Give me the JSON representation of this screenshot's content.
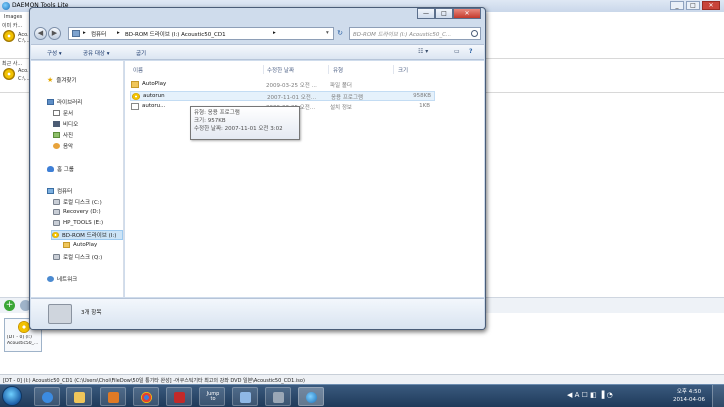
{
  "daemon": {
    "title": "DAEMON Tools Lite",
    "images_section": "Images",
    "image_catalog_label": "이미 카...",
    "recent_label": "최근 사...",
    "catalog_items": [
      {
        "name": "Aco...",
        "sub": "C:\\..."
      },
      {
        "name": "Aco...",
        "sub": "C:\\..."
      }
    ],
    "vdrive_label_1": "[DT - 0] (I:)",
    "vdrive_label_2": "Acoustic50_...",
    "status_text": "[DT - 0] (I:) Acoustic50_CD1 (C:\\Users\\Choi\\FileDow\\50일 통기타 완성] -어쿠스틱기타 최고의 강좌 DVD 일본\\Acoustic50_CD1.iso)"
  },
  "explorer": {
    "controls": {
      "min": "—",
      "max": "□",
      "close": "✕"
    },
    "address": {
      "crumbs": [
        "컴퓨터",
        "BD-ROM 드라이브 (I:) Acoustic50_CD1"
      ],
      "separator": "▸"
    },
    "search_placeholder": "BD-ROM 드라이브 (I:) Acoustic50_C...",
    "commands": {
      "organize": "구성 ▾",
      "share": "공유 대상 ▾",
      "burn": "굽기",
      "view": "☷ ▾",
      "help": "?"
    },
    "nav": [
      {
        "label": "즐겨찾기",
        "icon": "star-icon",
        "indent": 0
      },
      {
        "label": "라이브러리",
        "icon": "library-icon",
        "indent": 0
      },
      {
        "label": "문서",
        "icon": "documents-icon",
        "indent": 1
      },
      {
        "label": "비디오",
        "icon": "video-icon",
        "indent": 1
      },
      {
        "label": "사진",
        "icon": "pictures-icon",
        "indent": 1
      },
      {
        "label": "음악",
        "icon": "music-icon",
        "indent": 1
      },
      {
        "label": "홈 그룹",
        "icon": "homegroup-icon",
        "indent": 0
      },
      {
        "label": "컴퓨터",
        "icon": "computer-icon",
        "indent": 0
      },
      {
        "label": "로컬 디스크 (C:)",
        "icon": "hard-disk-icon",
        "indent": 1
      },
      {
        "label": "Recovery (D:)",
        "icon": "hard-disk-icon",
        "indent": 1
      },
      {
        "label": "HP_TOOLS (E:)",
        "icon": "hard-disk-icon",
        "indent": 1
      },
      {
        "label": "BD-ROM 드라이브 (I:)",
        "icon": "cd-drive-icon",
        "indent": 1,
        "selected": true
      },
      {
        "label": "AutoPlay",
        "icon": "folder-icon",
        "indent": 2
      },
      {
        "label": "로컬 디스크 (Q:)",
        "icon": "hard-disk-icon",
        "indent": 1
      },
      {
        "label": "네트워크",
        "icon": "network-icon",
        "indent": 0
      }
    ],
    "columns": {
      "name": "이름",
      "date": "수정한 날짜",
      "type": "유형",
      "size": "크기"
    },
    "files": [
      {
        "name": "AutoPlay",
        "date": "2009-03-25 오전 ...",
        "type": "파일 폴더",
        "size": "",
        "icon": "folder-icon"
      },
      {
        "name": "autorun",
        "date": "2007-11-01 오전...",
        "type": "응용 프로그램",
        "size": "958KB",
        "icon": "app-icon"
      },
      {
        "name": "autoru...",
        "date": "2009-03-25 오전...",
        "type": "설치 정보",
        "size": "1KB",
        "icon": "setup-info-icon"
      }
    ],
    "tooltip": {
      "line1": "유형: 응용 프로그램",
      "line2": "크기: 957KB",
      "line3": "수정한 날짜: 2007-11-01 오전 3:02"
    },
    "details": {
      "count": "3개 항목"
    }
  },
  "taskbar": {
    "apps": [
      {
        "name": "explorer",
        "text": ""
      },
      {
        "name": "media-player",
        "text": ""
      },
      {
        "name": "chrome",
        "text": ""
      },
      {
        "name": "app-red",
        "text": ""
      },
      {
        "name": "jump",
        "text": "Jump\nto"
      },
      {
        "name": "note",
        "text": ""
      },
      {
        "name": "app-grid",
        "text": ""
      },
      {
        "name": "daemon",
        "text": ""
      }
    ],
    "tray": "◀ A ☐ ◧ ▐ ◔",
    "time": "오후 4:50",
    "date": "2014-04-06"
  }
}
